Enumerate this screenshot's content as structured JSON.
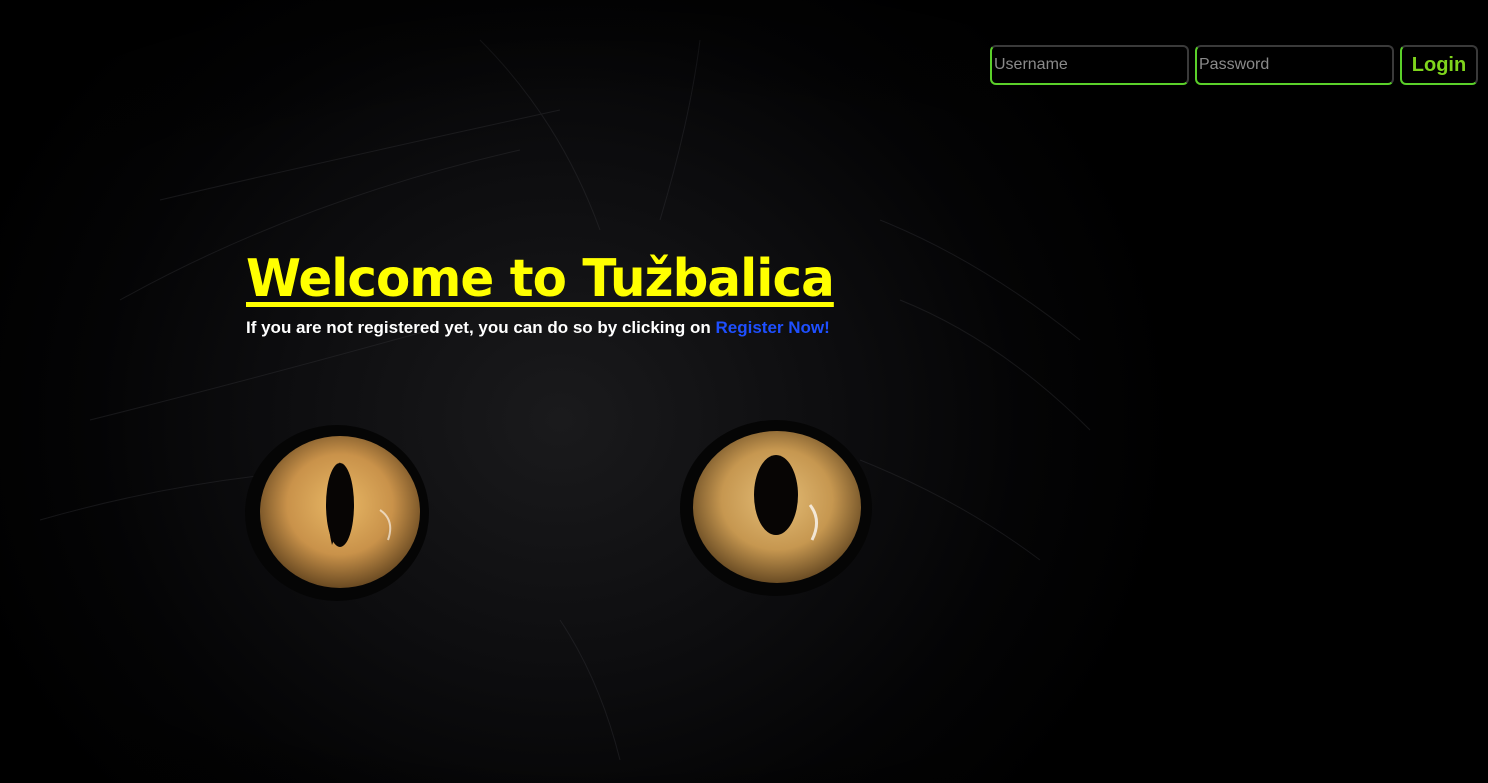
{
  "login": {
    "username_placeholder": "Username",
    "password_placeholder": "Password",
    "login_label": "Login"
  },
  "hero": {
    "title": "Welcome to Tužbalica",
    "subtitle": "If you are not registered yet, you can do so by clicking on",
    "register_link": "Register Now!"
  },
  "colors": {
    "title": "#ffff00",
    "link": "#1e4fff",
    "accent": "#5bd02a",
    "login_text": "#7fd51c"
  }
}
